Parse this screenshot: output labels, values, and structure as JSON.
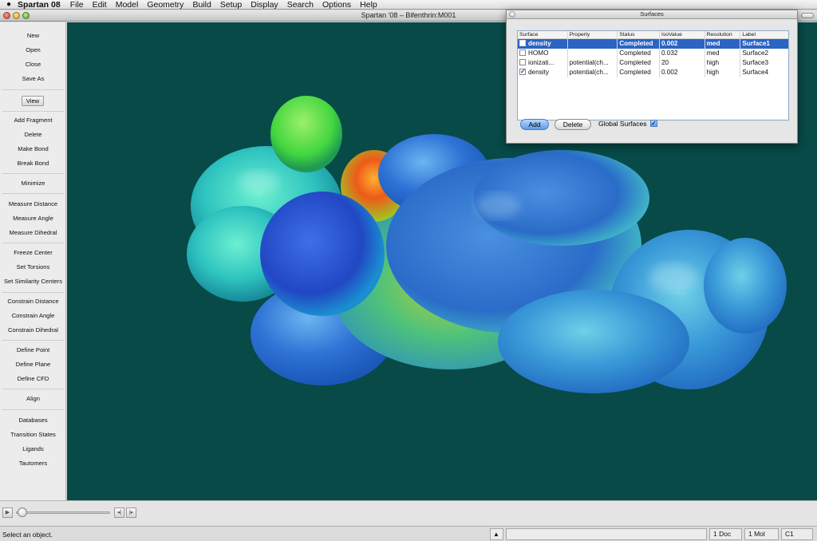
{
  "menubar": {
    "apple": "",
    "app_name": "Spartan 08",
    "items": [
      "File",
      "Edit",
      "Model",
      "Geometry",
      "Build",
      "Setup",
      "Display",
      "Search",
      "Options",
      "Help"
    ]
  },
  "window": {
    "title": "Spartan '08 – Bifenthrin:M001"
  },
  "sidebar": {
    "items": [
      "New",
      "Open",
      "Close",
      "Save As",
      "View",
      "Add Fragment",
      "Delete",
      "Make Bond",
      "Break Bond",
      "Minimize",
      "Measure Distance",
      "Measure Angle",
      "Measure Dihedral",
      "Freeze Center",
      "Set Torsions",
      "Set Similarity Centers",
      "Constrain Distance",
      "Constrain Angle",
      "Constrain Dihedral",
      "Define Point",
      "Define Plane",
      "Define CFD",
      "Align",
      "Databases",
      "Transition States",
      "Ligands",
      "Tautomers"
    ]
  },
  "dialog": {
    "title": "Surfaces",
    "columns": [
      "Surface",
      "Property",
      "Status",
      "IsoValue",
      "Resolution",
      "Label"
    ],
    "rows": [
      {
        "surface": "density",
        "property": "",
        "status": "Completed",
        "isovalue": "0.002",
        "resolution": "med",
        "label": "Surface1",
        "checked": false,
        "selected": true
      },
      {
        "surface": "HOMO",
        "property": "",
        "status": "Completed",
        "isovalue": "0.032",
        "resolution": "med",
        "label": "Surface2",
        "checked": false,
        "selected": false
      },
      {
        "surface": "ionizati...",
        "property": "potential(ch...",
        "status": "Completed",
        "isovalue": "20",
        "resolution": "high",
        "label": "Surface3",
        "checked": false,
        "selected": false
      },
      {
        "surface": "density",
        "property": "potential(ch...",
        "status": "Completed",
        "isovalue": "0.002",
        "resolution": "high",
        "label": "Surface4",
        "checked": true,
        "selected": false
      }
    ],
    "add_label": "Add",
    "delete_label": "Delete",
    "global_label": "Global Surfaces",
    "global_checked": true
  },
  "animation": {
    "play_icon": "▶",
    "prev_icon": "◂|",
    "next_icon": "|▸"
  },
  "status": {
    "message": "Select an object.",
    "up_icon": "▲",
    "doc_count": "1 Doc",
    "mol_count": "1 Mol",
    "symmetry": "C1"
  },
  "colors": {
    "viewport_bg": "#074a47",
    "selection": "#2a64c4"
  }
}
